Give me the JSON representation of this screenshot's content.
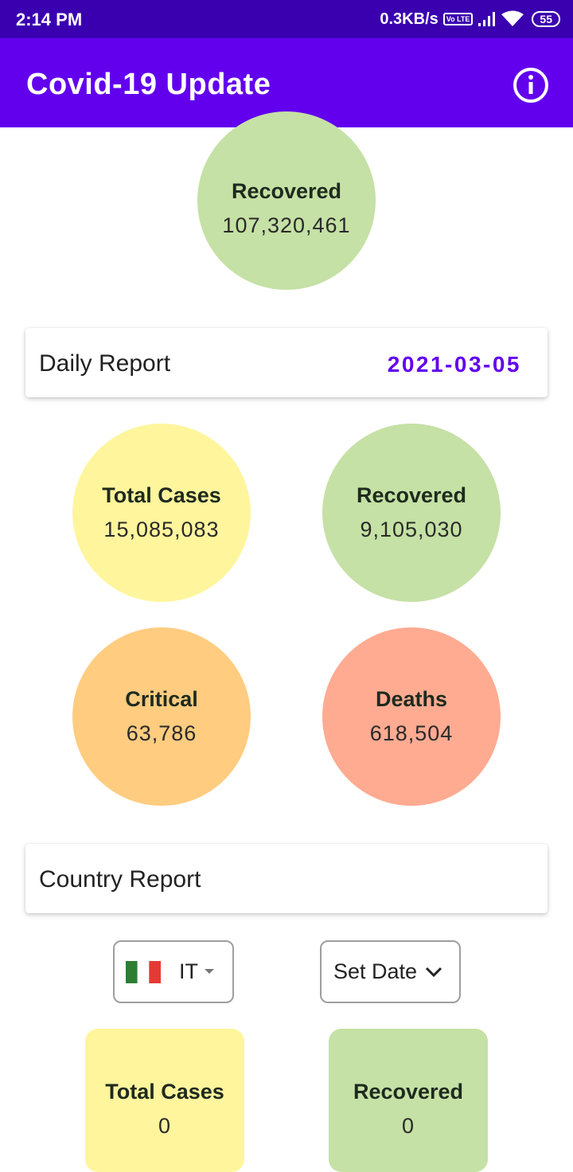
{
  "status_bar": {
    "time": "2:14 PM",
    "network_speed": "0.3KB/s",
    "volte": "Vo LTE",
    "battery": "55"
  },
  "app_bar": {
    "title": "Covid-19 Update",
    "info_icon": "info-icon"
  },
  "global": {
    "recovered": {
      "label": "Recovered",
      "value": "107,320,461",
      "color": "#c5e1a5"
    }
  },
  "daily_report": {
    "title": "Daily Report",
    "date": "2021-03-05",
    "stats": [
      {
        "label": "Total Cases",
        "value": "15,085,083",
        "color": "#fff59d"
      },
      {
        "label": "Recovered",
        "value": "9,105,030",
        "color": "#c5e1a5"
      },
      {
        "label": "Critical",
        "value": "63,786",
        "color": "#ffcc80"
      },
      {
        "label": "Deaths",
        "value": "618,504",
        "color": "#ffab91"
      }
    ]
  },
  "country_report": {
    "title": "Country Report",
    "country_code": "IT",
    "set_date_label": "Set Date",
    "stats": [
      {
        "label": "Total Cases",
        "value": "0",
        "color": "#fff59d"
      },
      {
        "label": "Recovered",
        "value": "0",
        "color": "#c5e1a5"
      }
    ]
  },
  "colors": {
    "status_bar": "#3a00b0",
    "app_bar": "#6200ee",
    "accent": "#6200ee"
  }
}
